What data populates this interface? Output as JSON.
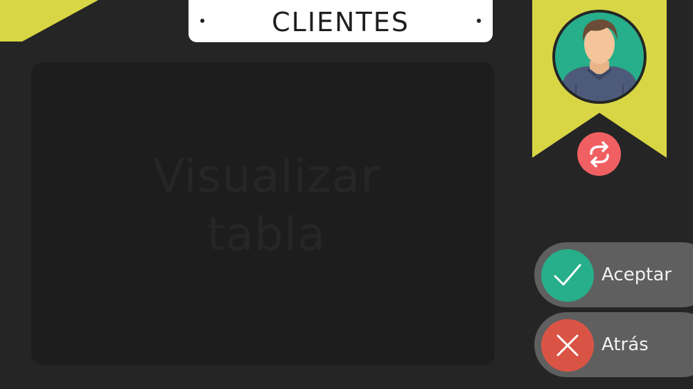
{
  "header": {
    "title": "CLIENTES"
  },
  "table_panel": {
    "line1": "Visualizar",
    "line2": "tabla"
  },
  "profile": {
    "avatar_icon": "user-avatar-icon",
    "swap_icon": "swap-arrows-icon"
  },
  "actions": {
    "accept": {
      "label": "Aceptar",
      "icon": "check-icon"
    },
    "back": {
      "label": "Atrás",
      "icon": "close-icon"
    }
  },
  "colors": {
    "background": "#252525",
    "panel": "#1d1d1d",
    "accent_yellow": "#d8d644",
    "accept_green": "#27ae8a",
    "back_red": "#da5445",
    "swap_red": "#f06062",
    "button_gray": "#5f5f5f"
  }
}
